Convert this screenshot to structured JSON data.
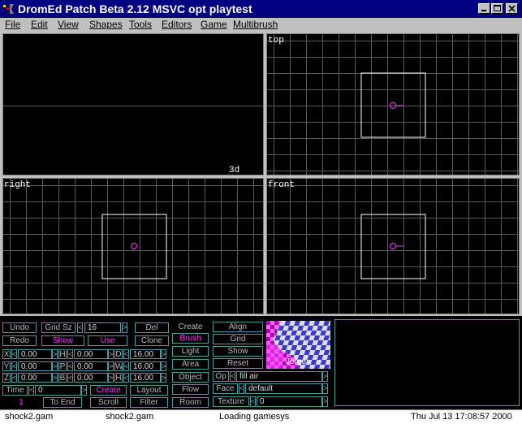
{
  "window": {
    "title": "DromEd Patch Beta 2.12 MSVC opt playtest",
    "icon": "dromed-app-icon"
  },
  "menu": [
    "File",
    "Edit",
    "View",
    "Shapes",
    "Tools",
    "Editors",
    "Game",
    "Multibrush"
  ],
  "viewports": {
    "v3d": "3d View",
    "top": "top",
    "right": "right",
    "front": "front"
  },
  "panel": {
    "undo": "Undo",
    "redo": "Redo",
    "grid_sz_label": "Grid Sz",
    "grid_sz_value": "16",
    "show": "Show",
    "use": "Use",
    "del": "Del",
    "clone": "Clone",
    "coords": [
      {
        "label": "X",
        "value": "0.00"
      },
      {
        "label": "H",
        "value": "0.00"
      },
      {
        "label": "D",
        "value": "16.00"
      },
      {
        "label": "Y",
        "value": "0.00"
      },
      {
        "label": "P",
        "value": "0.00"
      },
      {
        "label": "W",
        "value": "16.00"
      },
      {
        "label": "Z",
        "value": "0.00"
      },
      {
        "label": "B",
        "value": "0.00"
      },
      {
        "label": "H",
        "value": "16.00"
      }
    ],
    "time_label": "Time",
    "time_value": "0",
    "time_index": "1",
    "to_end": "To End",
    "create_btn": "Create",
    "layout": "Layout",
    "scroll": "Scroll",
    "filter": "Filter",
    "create_label": "Create",
    "brush": "Brush",
    "light": "Light",
    "area": "Area",
    "object": "Object",
    "flow": "Flow",
    "room": "Room",
    "align": "Align",
    "grid": "Grid",
    "show2": "Show",
    "reset": "Reset",
    "op_label": "Op",
    "op_value": "fill air",
    "face_label": "Face",
    "face_value": "default",
    "texture_label": "Texture",
    "texture_value": "0",
    "texture_name": "Jorge",
    "arrow_left": "<",
    "arrow_right": ">"
  },
  "status": {
    "left": "shock2.gam",
    "mid": "shock2.gam",
    "msg": "Loading gamesys",
    "time": "Thu Jul 13 17:08:57 2000"
  },
  "colors": {
    "title_bg": "#000080",
    "panel_border": "#4a9aa0",
    "highlight": "#ff33ff",
    "grid": "#5a5a5a",
    "brush_outline": "#ffffff",
    "brush_center": "#ff33ff"
  }
}
